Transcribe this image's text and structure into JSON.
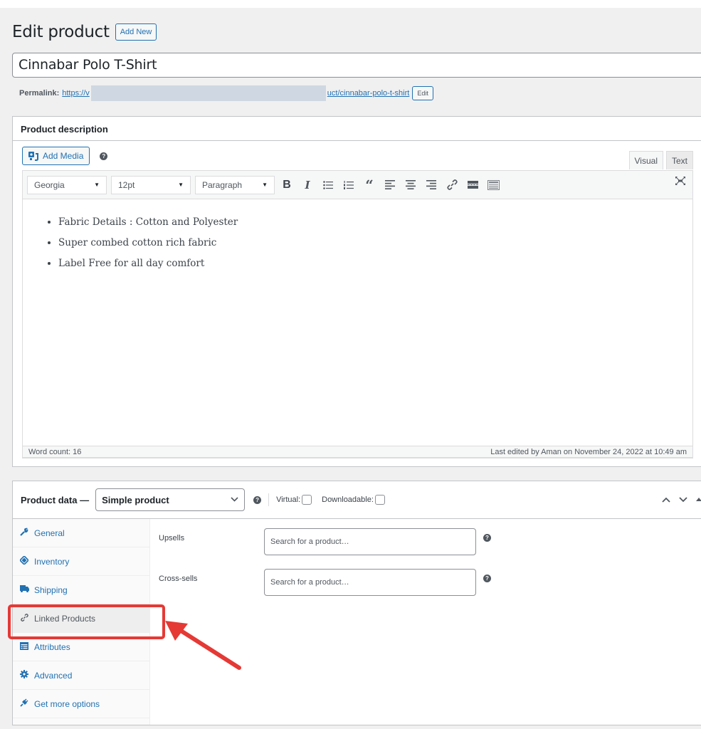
{
  "page": {
    "title": "Edit product",
    "add_new_label": "Add New"
  },
  "product": {
    "title": "Cinnabar Polo T-Shirt",
    "permalink_label": "Permalink:",
    "permalink_start": "https://v",
    "permalink_end": "uct/cinnabar-polo-t-shirt",
    "permalink_edit_label": "Edit"
  },
  "description": {
    "header": "Product description",
    "add_media_label": "Add Media",
    "tabs": [
      {
        "label": "Visual",
        "active": true
      },
      {
        "label": "Text",
        "active": false
      }
    ],
    "toolbar": {
      "font_family": "Georgia",
      "font_size": "12pt",
      "format": "Paragraph",
      "buttons": [
        "bold",
        "italic",
        "bulleted-list",
        "numbered-list",
        "blockquote",
        "align-left",
        "align-center",
        "align-right",
        "link",
        "read-more",
        "toolbar-toggle"
      ]
    },
    "bullets": [
      "Fabric Details : Cotton and Polyester",
      "Super combed cotton rich fabric",
      "Label Free for all day comfort"
    ],
    "word_count": "Word count: 16",
    "last_edited": "Last edited by Aman on November 24, 2022 at 10:49 am"
  },
  "product_data": {
    "title": "Product data —",
    "type_selected": "Simple product",
    "virtual_label": "Virtual:",
    "downloadable_label": "Downloadable:",
    "virtual_checked": false,
    "downloadable_checked": false,
    "tabs": [
      {
        "label": "General",
        "icon": "wrench-icon"
      },
      {
        "label": "Inventory",
        "icon": "tag-icon"
      },
      {
        "label": "Shipping",
        "icon": "truck-icon"
      },
      {
        "label": "Linked Products",
        "icon": "link-icon",
        "active": true
      },
      {
        "label": "Attributes",
        "icon": "table-icon"
      },
      {
        "label": "Advanced",
        "icon": "gear-icon"
      },
      {
        "label": "Get more options",
        "icon": "plugin-icon"
      }
    ],
    "fields": [
      {
        "label": "Upsells",
        "placeholder": "Search for a product…"
      },
      {
        "label": "Cross-sells",
        "placeholder": "Search for a product…"
      }
    ]
  },
  "annotation": {
    "highlight_color": "#e53935",
    "target": "Linked Products"
  }
}
